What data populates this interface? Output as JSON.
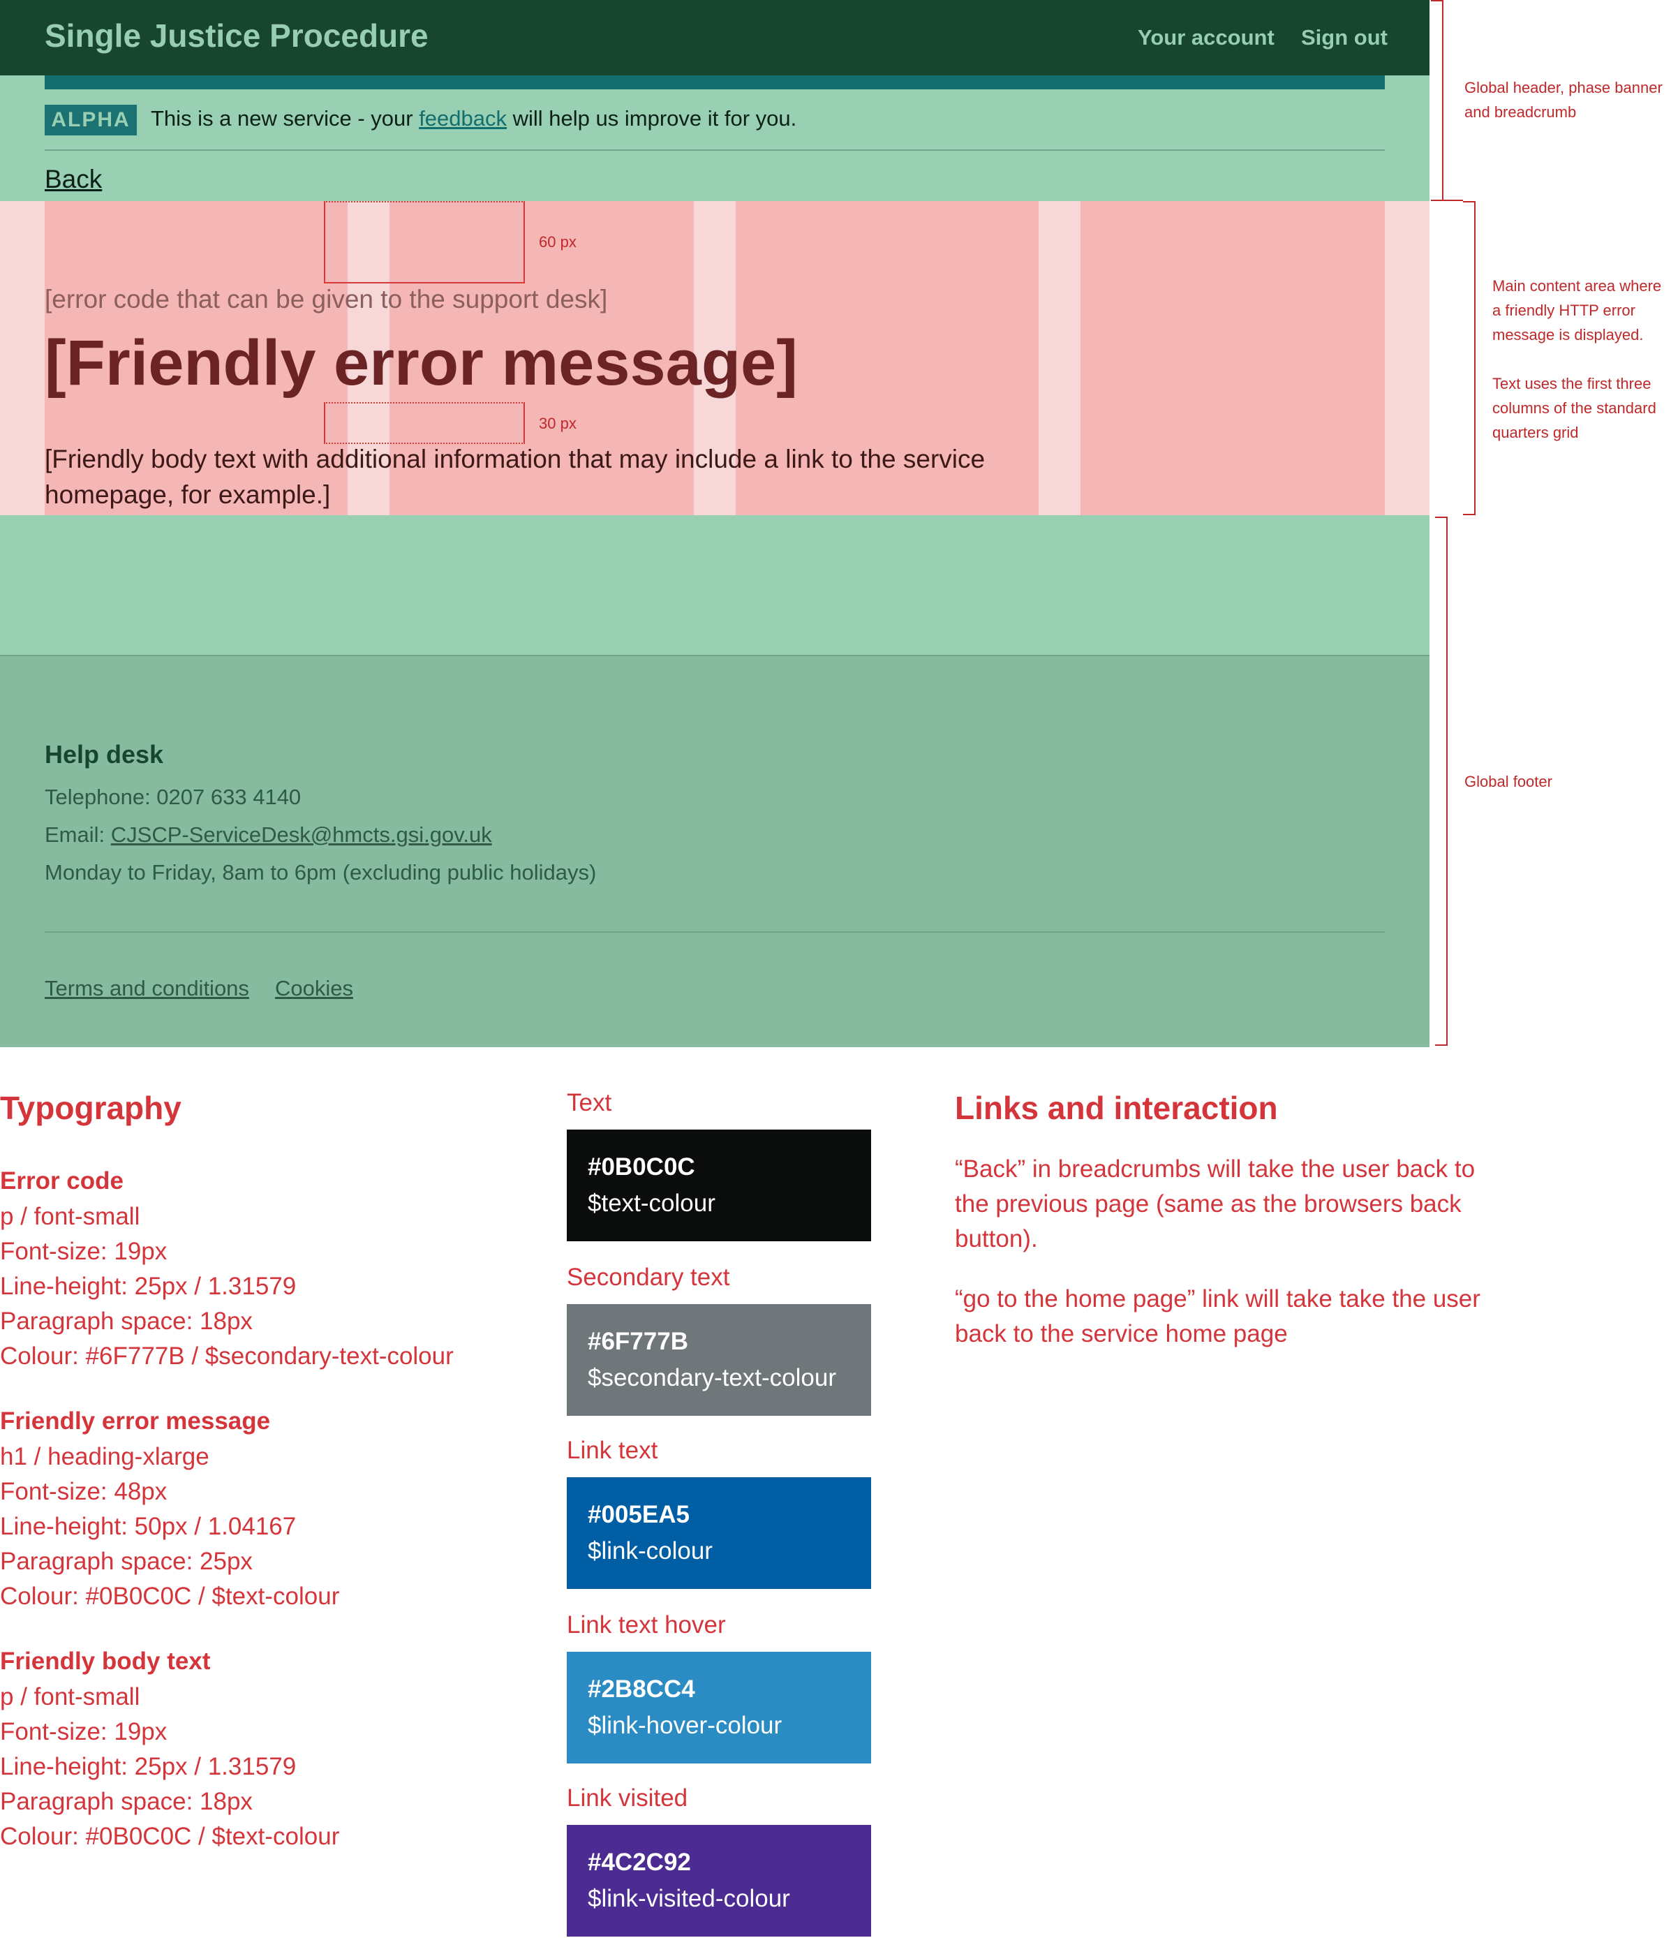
{
  "header": {
    "service_name": "Single Justice Procedure",
    "nav": [
      {
        "label": "Your account"
      },
      {
        "label": "Sign out"
      }
    ]
  },
  "phase_banner": {
    "tag": "ALPHA",
    "text_before": "This is a new service - your",
    "link_text": "feedback",
    "text_after": "will help us improve it for you."
  },
  "breadcrumb": {
    "back_label": "Back"
  },
  "error": {
    "code": "[error code that can be given to the support desk]",
    "heading": "[Friendly error message]",
    "body": "[Friendly body text with additional information that may include a link to the service homepage, for example.]",
    "spacing_labels": [
      "60 px",
      "30 px"
    ]
  },
  "footer": {
    "helpdesk_title": "Help desk",
    "phone": "Telephone: 0207 633 4140",
    "email_prefix": "Email:",
    "email": "CJSCP-ServiceDesk@hmcts.gsi.gov.uk",
    "hours": "Monday to Friday, 8am to 6pm (excluding public holidays)",
    "links": [
      {
        "label": "Terms and conditions"
      },
      {
        "label": "Cookies"
      }
    ]
  },
  "annotations": {
    "header": "Global header, phase banner and breadcrumb",
    "main": "Main content area where a friendly HTTP error message is displayed.",
    "main_grid": "Text uses the first three columns of the standard quarters grid",
    "footer": "Global footer"
  },
  "typography": {
    "heading": "Typography",
    "blocks": [
      {
        "title": "Error code",
        "lines": [
          "p / font-small",
          "Font-size: 19px",
          "Line-height: 25px / 1.31579",
          "Paragraph space: 18px",
          "Colour: #6F777B / $secondary-text-colour"
        ]
      },
      {
        "title": "Friendly error message",
        "lines": [
          "h1 / heading-xlarge",
          "Font-size: 48px",
          "Line-height: 50px / 1.04167",
          "Paragraph space: 25px",
          "Colour: #0B0C0C / $text-colour"
        ]
      },
      {
        "title": "Friendly body text",
        "lines": [
          "p / font-small",
          "Font-size: 19px",
          "Line-height: 25px / 1.31579",
          "Paragraph space: 18px",
          "Colour: #0B0C0C / $text-colour"
        ]
      }
    ]
  },
  "colours": [
    {
      "label": "Text",
      "hex": "#0B0C0C",
      "variable": "$text-colour",
      "color": "#0b0c0c"
    },
    {
      "label": "Secondary text",
      "hex": "#6F777B",
      "variable": "$secondary-text-colour",
      "color": "#6f777b"
    },
    {
      "label": "Link text",
      "hex": "#005EA5",
      "variable": "$link-colour",
      "color": "#005ea5"
    },
    {
      "label": "Link text hover",
      "hex": "#2B8CC4",
      "variable": "$link-hover-colour",
      "color": "#2b8cc4"
    },
    {
      "label": "Link visited",
      "hex": "#4C2C92",
      "variable": "$link-visited-colour",
      "color": "#4c2c92"
    }
  ],
  "links_interaction": {
    "heading": "Links and interaction",
    "paragraphs": [
      "“Back” in breadcrumbs will take the user back to the previous page (same as the browsers back button).",
      "“go to the home page” link will take take the user back to the service home page"
    ]
  }
}
